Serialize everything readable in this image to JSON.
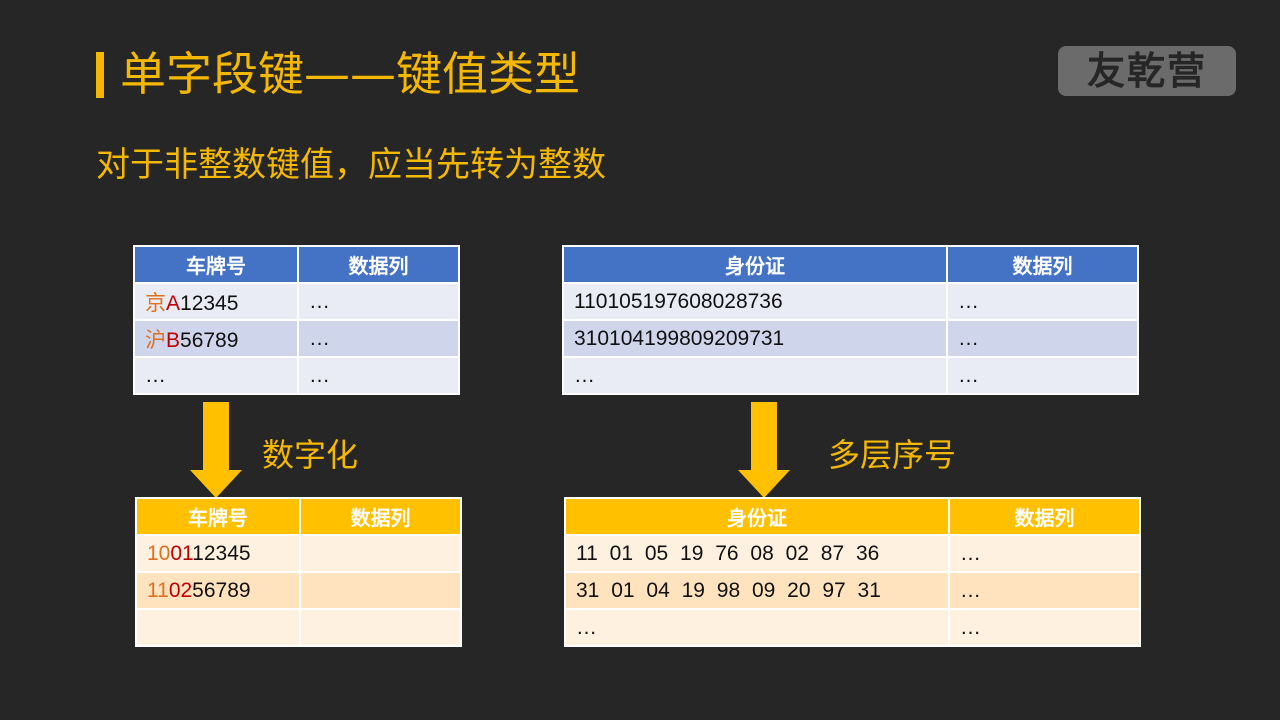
{
  "header": {
    "title": "单字段键——键值类型",
    "logo_text": "友乾营",
    "subtitle": "对于非整数键值，应当先转为整数"
  },
  "left_top_table": {
    "headers": [
      "车牌号",
      "数据列"
    ],
    "rows": [
      {
        "prefix": "京",
        "letter": "A",
        "rest": "12345",
        "data": "…"
      },
      {
        "prefix": "沪",
        "letter": "B",
        "rest": "56789",
        "data": "…"
      },
      {
        "prefix": "",
        "letter": "",
        "rest": "…",
        "data": "…"
      }
    ]
  },
  "left_arrow_label": "数字化",
  "left_bottom_table": {
    "headers": [
      "车牌号",
      "数据列"
    ],
    "rows": [
      {
        "prefix": "10",
        "letter": "01",
        "rest": "12345",
        "data": ""
      },
      {
        "prefix": "11",
        "letter": "02",
        "rest": "56789",
        "data": ""
      },
      {
        "prefix": "",
        "letter": "",
        "rest": "",
        "data": ""
      }
    ]
  },
  "right_top_table": {
    "headers": [
      "身份证",
      "数据列"
    ],
    "rows": [
      {
        "id": "110105197608028736",
        "data": "…"
      },
      {
        "id": "310104199809209731",
        "data": "…"
      },
      {
        "id": "…",
        "data": "…"
      }
    ]
  },
  "right_arrow_label": "多层序号",
  "right_bottom_table": {
    "headers": [
      "身份证",
      "数据列"
    ],
    "rows": [
      {
        "id": "11 01 05 19 76 08 02 87 36",
        "data": "…"
      },
      {
        "id": "31 01 04 19 98 09 20 97 31",
        "data": "…"
      },
      {
        "id": "…",
        "data": "…"
      }
    ]
  },
  "colors": {
    "accent": "#f5b800",
    "blue_header": "#4472c4",
    "gold_header": "#ffc000"
  }
}
